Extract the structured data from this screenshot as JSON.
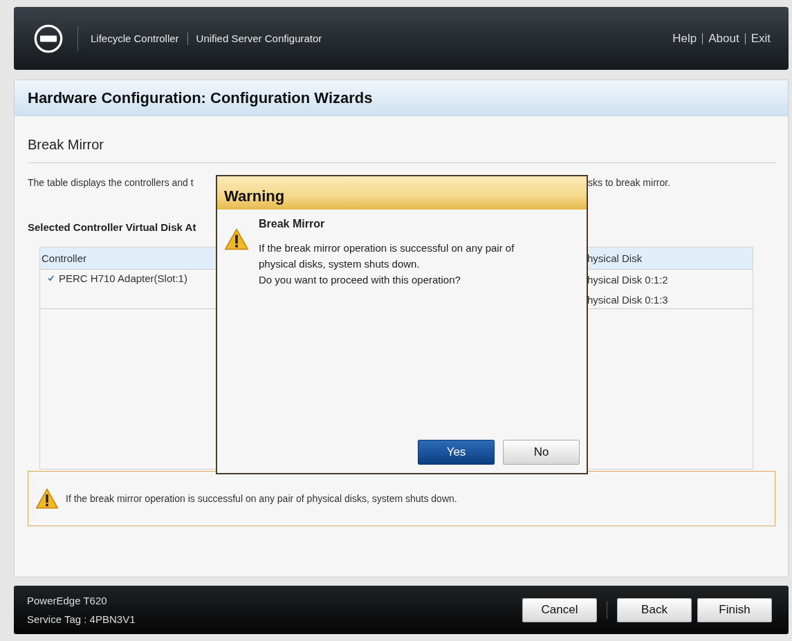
{
  "header": {
    "product": "Lifecycle Controller",
    "subtitle": "Unified Server Configurator",
    "links": [
      "Help",
      "About",
      "Exit"
    ]
  },
  "page": {
    "title": "Hardware Configuration: Configuration Wizards",
    "section": "Break Mirror",
    "description_parts": [
      "The table displays the controllers and t",
      "sks to break mirror."
    ],
    "subheading": "Selected Controller Virtual Disk At",
    "table": {
      "columns": [
        "Controller",
        "hysical Disk"
      ],
      "controllers": [
        {
          "label": "PERC H710 Adapter(Slot:1)",
          "checked": true
        }
      ],
      "disks": [
        "hysical Disk 0:1:2",
        "hysical Disk 0:1:3"
      ]
    },
    "warning": "If the break mirror operation is successful on any pair of physical disks, system shuts down."
  },
  "dialog": {
    "title": "Warning",
    "heading": "Break Mirror",
    "lines": [
      "If the break mirror operation is successful on any pair of",
      "physical disks, system shuts down.",
      "Do you want to proceed with this operation?"
    ],
    "buttons": [
      {
        "label": "Yes",
        "kind": "primary"
      },
      {
        "label": "No",
        "kind": "secondary"
      }
    ]
  },
  "footer": {
    "model": "PowerEdge T620",
    "service_tag": "Service Tag : 4PBN3V1",
    "buttons": [
      "Cancel",
      "Back",
      "Finish"
    ]
  }
}
